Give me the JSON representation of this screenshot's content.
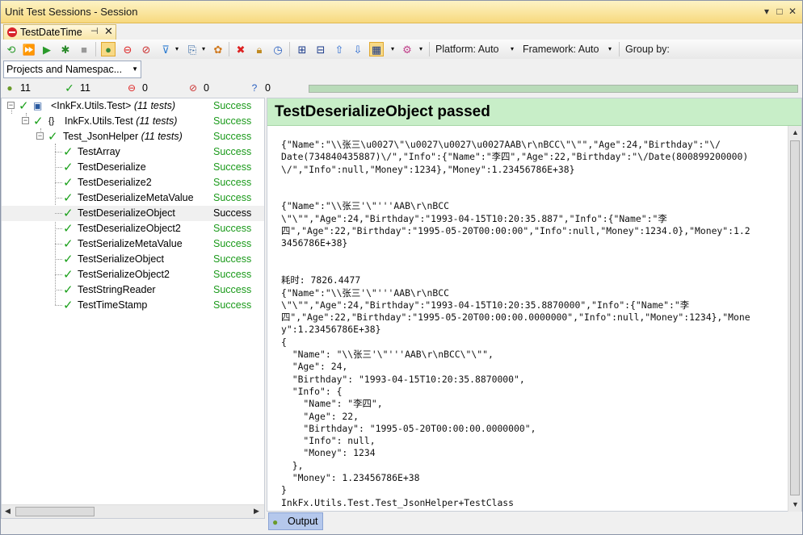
{
  "window": {
    "title": "Unit Test Sessions - Session"
  },
  "tab": {
    "label": "TestDateTime"
  },
  "toolbar": {
    "platform_label": "Platform: Auto",
    "framework_label": "Framework: Auto",
    "groupby_label": "Group by:"
  },
  "grouping": {
    "value": "Projects and Namespac..."
  },
  "counters": {
    "total": "11",
    "passed": "11",
    "failed": "0",
    "ignored": "0",
    "unknown": "0"
  },
  "progress": {
    "fraction": 1.0,
    "color": "#b9dbb9"
  },
  "tree": {
    "project": {
      "name": "<InkFx.Utils.Test>",
      "count": "(11 tests)",
      "status": "Success"
    },
    "namespace": {
      "name": "InkFx.Utils.Test",
      "count": "(11 tests)",
      "status": "Success"
    },
    "fixture": {
      "name": "Test_JsonHelper",
      "count": "(11 tests)",
      "status": "Success"
    },
    "tests": [
      {
        "name": "TestArray",
        "status": "Success"
      },
      {
        "name": "TestDeserialize",
        "status": "Success"
      },
      {
        "name": "TestDeserialize2",
        "status": "Success"
      },
      {
        "name": "TestDeserializeMetaValue",
        "status": "Success"
      },
      {
        "name": "TestDeserializeObject",
        "status": "Success"
      },
      {
        "name": "TestDeserializeObject2",
        "status": "Success"
      },
      {
        "name": "TestSerializeMetaValue",
        "status": "Success"
      },
      {
        "name": "TestSerializeObject",
        "status": "Success"
      },
      {
        "name": "TestSerializeObject2",
        "status": "Success"
      },
      {
        "name": "TestStringReader",
        "status": "Success"
      },
      {
        "name": "TestTimeStamp",
        "status": "Success"
      }
    ],
    "selected_index": 4
  },
  "output": {
    "header": "TestDeserializeObject passed",
    "lines": [
      "{\"Name\":\"\\\\张三\\u0027\\\"\\u0027\\u0027\\u0027AAB\\r\\nBCC\\\"\\\"\",\"Age\":24,\"Birthday\":\"\\/",
      "Date(734840435887)\\/\",\"Info\":{\"Name\":\"李四\",\"Age\":22,\"Birthday\":\"\\/Date(800899200000)",
      "\\/\",\"Info\":null,\"Money\":1234},\"Money\":1.23456786E+38}",
      "",
      "",
      "{\"Name\":\"\\\\张三'\\\"'''AAB\\r\\nBCC",
      "\\\"\\\"\",\"Age\":24,\"Birthday\":\"1993-04-15T10:20:35.887\",\"Info\":{\"Name\":\"李",
      "四\",\"Age\":22,\"Birthday\":\"1995-05-20T00:00:00\",\"Info\":null,\"Money\":1234.0},\"Money\":1.2",
      "3456786E+38}",
      "",
      "",
      "耗时: 7826.4477",
      "{\"Name\":\"\\\\张三'\\\"'''AAB\\r\\nBCC",
      "\\\"\\\"\",\"Age\":24,\"Birthday\":\"1993-04-15T10:20:35.8870000\",\"Info\":{\"Name\":\"李",
      "四\",\"Age\":22,\"Birthday\":\"1995-05-20T00:00:00.0000000\",\"Info\":null,\"Money\":1234},\"Mone",
      "y\":1.23456786E+38}",
      "{",
      "  \"Name\": \"\\\\张三'\\\"'''AAB\\r\\nBCC\\\"\\\"\",",
      "  \"Age\": 24,",
      "  \"Birthday\": \"1993-04-15T10:20:35.8870000\",",
      "  \"Info\": {",
      "    \"Name\": \"李四\",",
      "    \"Age\": 22,",
      "    \"Birthday\": \"1995-05-20T00:00:00.0000000\",",
      "    \"Info\": null,",
      "    \"Money\": 1234",
      "  },",
      "  \"Money\": 1.23456786E+38",
      "}",
      "InkFx.Utils.Test.Test_JsonHelper+TestClass"
    ]
  },
  "bottom_tab": {
    "label": "Output"
  }
}
